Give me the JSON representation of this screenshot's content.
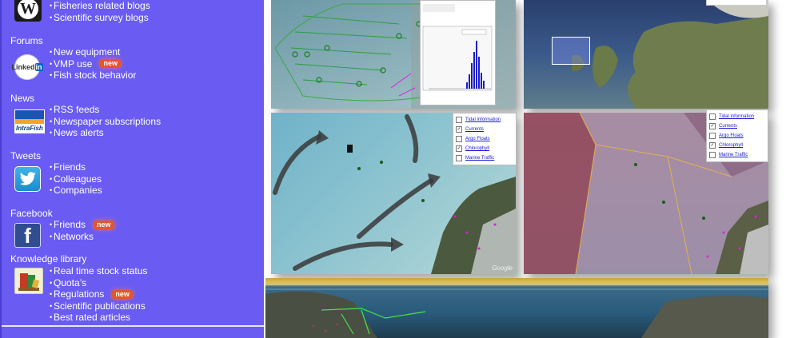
{
  "sidebar": {
    "badge_label": "new",
    "sections": [
      {
        "id": "blogs",
        "title": "",
        "icon": "wordpress-icon",
        "items": [
          {
            "label": "Fisheries related blogs"
          },
          {
            "label": "Scientific survey blogs"
          }
        ]
      },
      {
        "id": "forums",
        "title": "Forums",
        "icon": "linkedin-icon",
        "items": [
          {
            "label": "New equipment"
          },
          {
            "label": "VMP use",
            "badge": true
          },
          {
            "label": "Fish stock behavior"
          }
        ]
      },
      {
        "id": "news",
        "title": "News",
        "icon": "intrafish-icon",
        "icon_text": "IntraFish",
        "items": [
          {
            "label": "RSS feeds"
          },
          {
            "label": "Newspaper subscriptions"
          },
          {
            "label": "News alerts"
          }
        ]
      },
      {
        "id": "tweets",
        "title": "Tweets",
        "icon": "twitter-icon",
        "items": [
          {
            "label": "Friends"
          },
          {
            "label": "Colleagues"
          },
          {
            "label": "Companies"
          }
        ]
      },
      {
        "id": "facebook",
        "title": "Facebook",
        "icon": "facebook-icon",
        "items": [
          {
            "label": "Friends",
            "badge": true
          },
          {
            "label": "Networks"
          }
        ]
      },
      {
        "id": "knowledge",
        "title": "Knowledge library",
        "icon": "books-icon",
        "items": [
          {
            "label": "Real time stock status"
          },
          {
            "label": "Quota’s"
          },
          {
            "label": "Regulations",
            "badge": true
          },
          {
            "label": "Scientific publications"
          },
          {
            "label": "Best rated articles"
          }
        ]
      }
    ]
  },
  "map_layers": {
    "items": [
      {
        "label": "Tidal information",
        "checked": false
      },
      {
        "label": "Currents",
        "checked": true
      },
      {
        "label": "Argo Floats",
        "checked": false
      },
      {
        "label": "Chlorophyll",
        "checked": true
      },
      {
        "label": "Marine Traffic",
        "checked": false
      }
    ]
  },
  "map_attribution": "Google",
  "colors": {
    "sidebar_bg": "#6a5cf2",
    "badge": "#e4552c",
    "link": "#1a1ad8"
  }
}
